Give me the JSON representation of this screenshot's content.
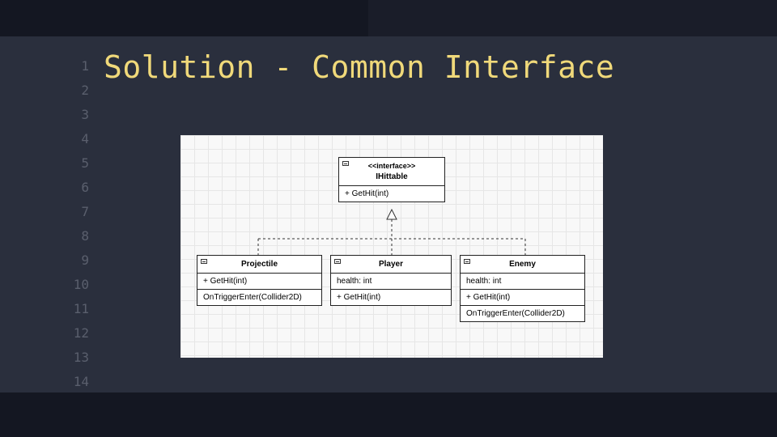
{
  "slide": {
    "title": "Solution - Common Interface",
    "line_numbers": [
      "1",
      "2",
      "3",
      "4",
      "5",
      "6",
      "7",
      "8",
      "9",
      "10",
      "11",
      "12",
      "13",
      "14"
    ]
  },
  "colors": {
    "bg_outer": "#1a1d29",
    "bg_content": "#2a2f3d",
    "bg_bars": "#141722",
    "title": "#f0d97a",
    "line_num": "#5a5f6d"
  },
  "diagram": {
    "interface": {
      "stereotype": "<<interface>>",
      "name": "IHittable",
      "methods": [
        "+ GetHit(int)"
      ]
    },
    "classes": [
      {
        "name": "Projectile",
        "fields": [],
        "methods": [
          "+ GetHit(int)",
          "OnTriggerEnter(Collider2D)"
        ]
      },
      {
        "name": "Player",
        "fields": [
          "health: int"
        ],
        "methods": [
          "+ GetHit(int)"
        ]
      },
      {
        "name": "Enemy",
        "fields": [
          "health: int"
        ],
        "methods": [
          "+ GetHit(int)",
          "OnTriggerEnter(Collider2D)"
        ]
      }
    ],
    "relation": "realization"
  }
}
